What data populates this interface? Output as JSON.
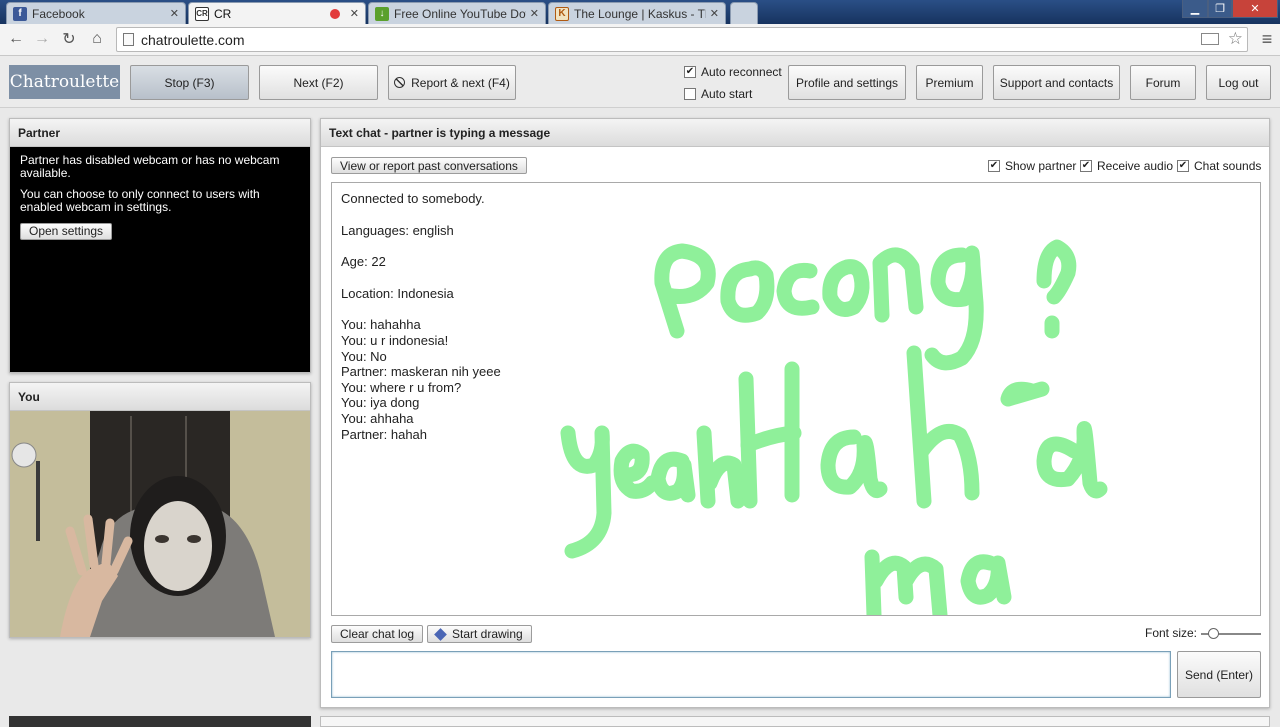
{
  "browser": {
    "tabs": [
      {
        "title": "Facebook",
        "icon": "facebook-icon"
      },
      {
        "title": "CR",
        "icon": "chatroulette-icon"
      },
      {
        "title": "Free Online YouTube Dow",
        "icon": "download-icon"
      },
      {
        "title": "The Lounge | Kaskus - The",
        "icon": "kaskus-icon"
      }
    ],
    "url": "chatroulette.com"
  },
  "header": {
    "logo": "Chatroulette",
    "stop_label": "Stop (F3)",
    "next_label": "Next (F2)",
    "report_label": "Report & next (F4)",
    "auto_reconnect_label": "Auto reconnect",
    "auto_start_label": "Auto start",
    "profile_label": "Profile and settings",
    "premium_label": "Premium",
    "support_label": "Support and contacts",
    "forum_label": "Forum",
    "logout_label": "Log out"
  },
  "partner_panel": {
    "title": "Partner",
    "message1": "Partner has disabled webcam or has no webcam available.",
    "message2": "You can choose to only connect to users with enabled webcam in settings.",
    "settings_button": "Open settings"
  },
  "you_panel": {
    "title": "You"
  },
  "chat": {
    "title": "Text chat - partner is typing a message",
    "past_button": "View or report past conversations",
    "show_partner_label": "Show partner",
    "receive_audio_label": "Receive audio",
    "chat_sounds_label": "Chat sounds",
    "messages": [
      "Connected to somebody.",
      "",
      "Languages: english",
      "",
      "Age: 22",
      "",
      "Location: Indonesia",
      "",
      "You: hahahha",
      "You: u r indonesia!",
      "You: No",
      "Partner: maskeran nih yeee",
      "You: where r u from?",
      "You: iya dong",
      "You: ahhaha",
      "Partner: hahah"
    ],
    "clear_button": "Clear chat log",
    "draw_button": "Start drawing",
    "font_size_label": "Font size:",
    "font_size_level": 0.2,
    "send_button": "Send (Enter)",
    "input_value": ""
  },
  "colors": {
    "drawing": "#8ff09a",
    "logo_bg": "#7d8fa5",
    "stop_bg": "#c3cad3"
  }
}
